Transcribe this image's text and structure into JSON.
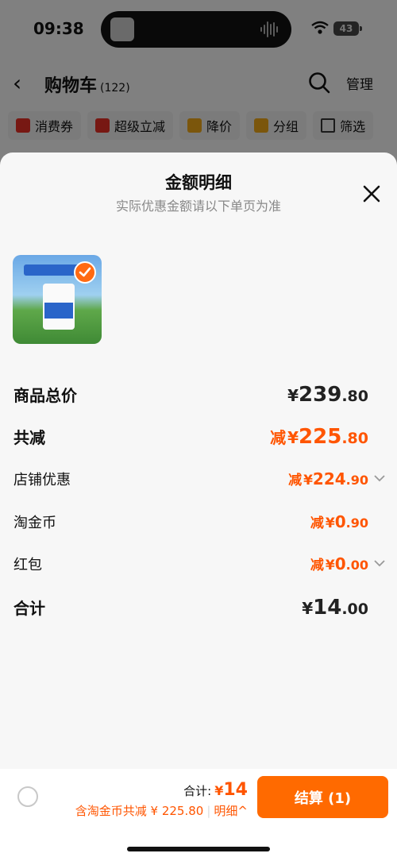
{
  "status_bar": {
    "time": "09:38",
    "battery": "43"
  },
  "nav": {
    "back_glyph": "‹",
    "title": "购物车",
    "count": "(122)",
    "manage": "管理"
  },
  "filters": [
    {
      "label": "消费券",
      "color": "#e02e24"
    },
    {
      "label": "超级立减",
      "color": "#e02e24"
    },
    {
      "label": "降价",
      "color": "#e8a317"
    },
    {
      "label": "分组",
      "color": "#e8a317"
    },
    {
      "label": "筛选",
      "color": "#333333"
    }
  ],
  "sheet": {
    "title": "金额明细",
    "subtitle": "实际优惠金额请以下单页为准",
    "rows": [
      {
        "label": "商品总价",
        "prefix": "",
        "currency": "¥",
        "int": "239",
        "dec": ".80"
      },
      {
        "label": "共减",
        "prefix": "减",
        "currency": "¥",
        "int": "225",
        "dec": ".80"
      },
      {
        "label": "店铺优惠",
        "prefix": "减",
        "currency": "¥",
        "int": "224",
        "dec": ".90"
      },
      {
        "label": "淘金币",
        "prefix": "减",
        "currency": "¥",
        "int": "0",
        "dec": ".90"
      },
      {
        "label": "红包",
        "prefix": "减",
        "currency": "¥",
        "int": "0",
        "dec": ".00"
      },
      {
        "label": "合计",
        "prefix": "",
        "currency": "¥",
        "int": "14",
        "dec": ".00"
      }
    ]
  },
  "footer": {
    "total_label": "合计:",
    "total_currency": "¥",
    "total_value": "14",
    "discount_text": "含淘金币共减 ¥ 225.80",
    "detail_link": "明细",
    "detail_chevron": "^",
    "pay_button": "结算 (1)"
  },
  "colors": {
    "accent": "#ff5500",
    "button": "#ff6a00"
  }
}
